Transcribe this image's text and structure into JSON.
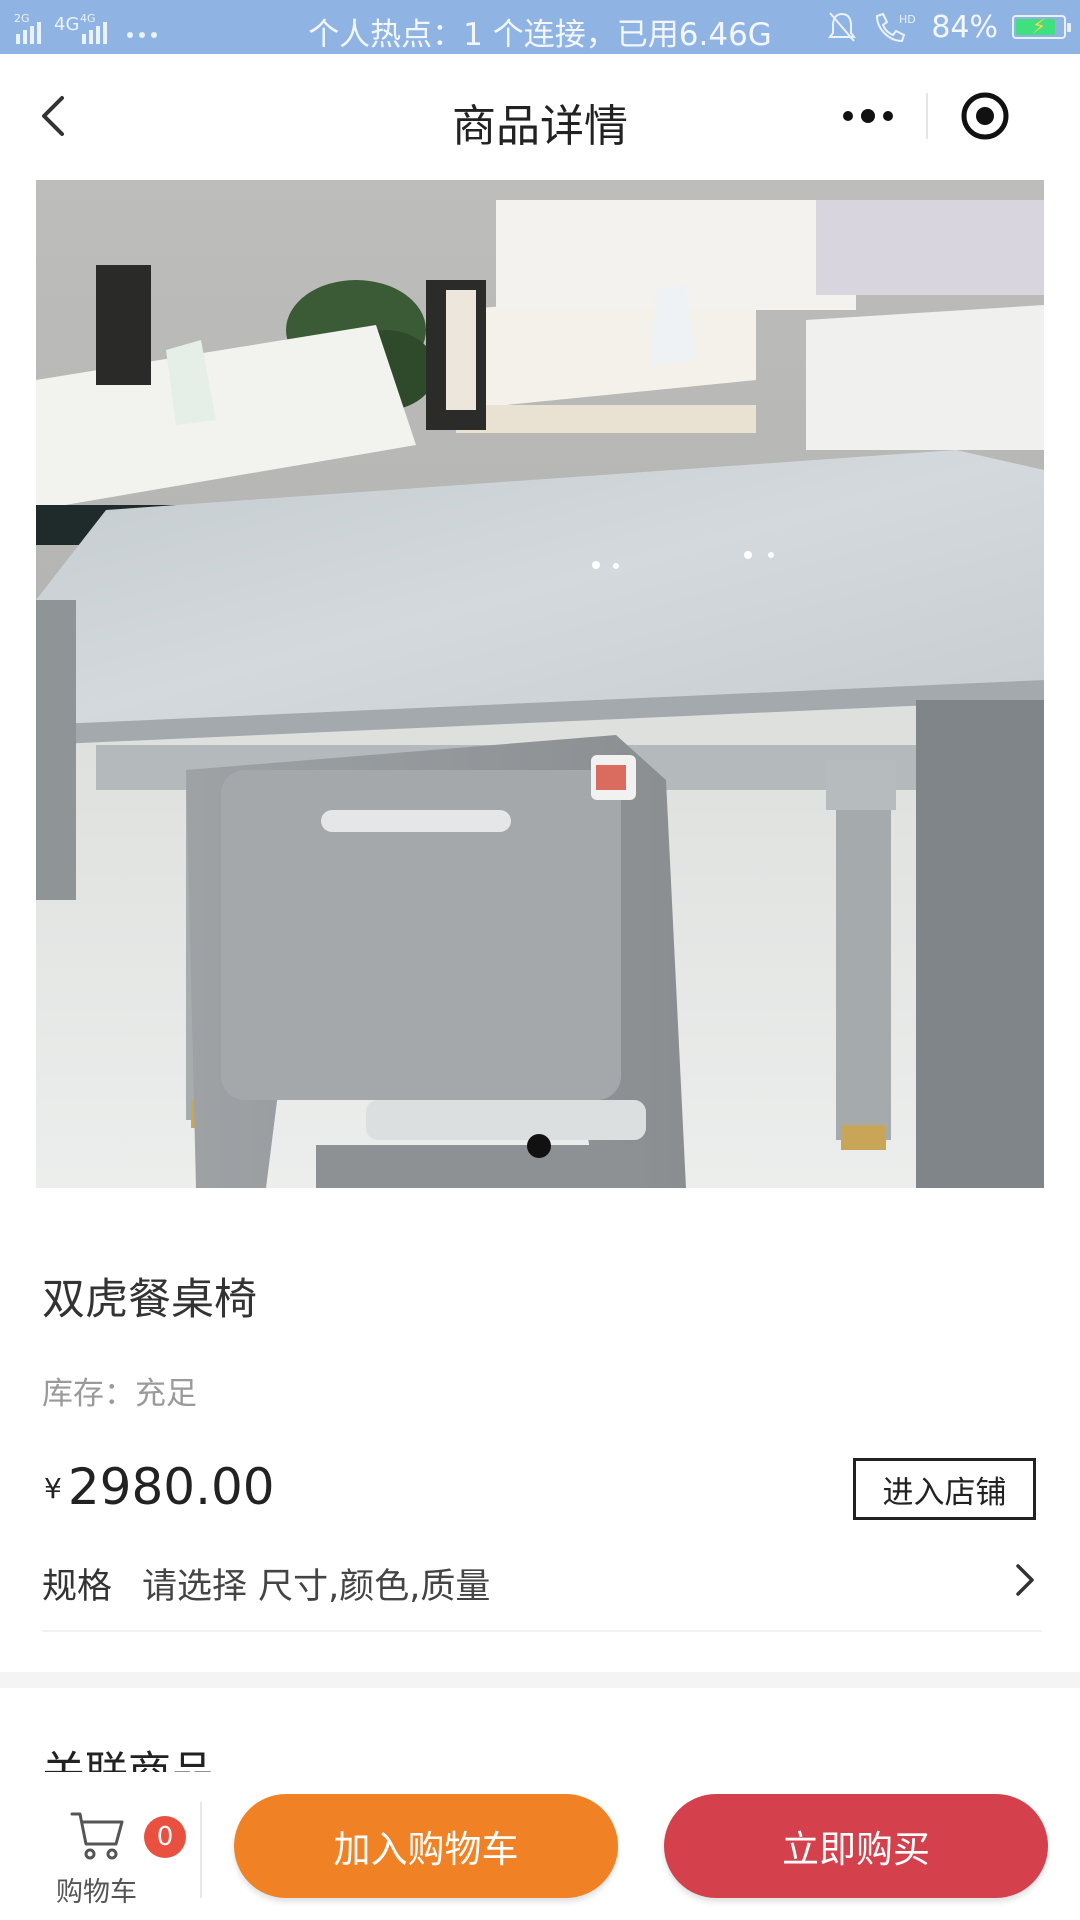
{
  "status_bar": {
    "network_label": "2G 4G 4G",
    "hotspot_text": "个人热点：1 个连接，已用6.46G",
    "signal_extra": "HD",
    "battery_percent": "84%",
    "battery_level": 0.84,
    "battery_color": "#3fe07d"
  },
  "nav": {
    "title": "商品详情",
    "back_icon": "chevron-left-icon",
    "more_icon": "more-dots-icon",
    "close_icon": "target-circle-icon"
  },
  "gallery": {
    "image_description_icon": "product-photo",
    "page_indicator_count": 1,
    "active_index": 0
  },
  "product": {
    "name": "双虎餐桌椅",
    "stock": "库存：充足",
    "currency": "¥",
    "price": "2980.00",
    "shop_button": "进入店铺",
    "spec_label": "规格",
    "spec_value": "请选择 尺寸,颜色,质量"
  },
  "related": {
    "title": "关联商品"
  },
  "bottom_bar": {
    "cart_label": "购物车",
    "cart_count": "0",
    "add_to_cart": "加入购物车",
    "buy_now": "立即购买",
    "add_to_cart_color": "#f08225",
    "buy_now_color": "#d4404b"
  }
}
